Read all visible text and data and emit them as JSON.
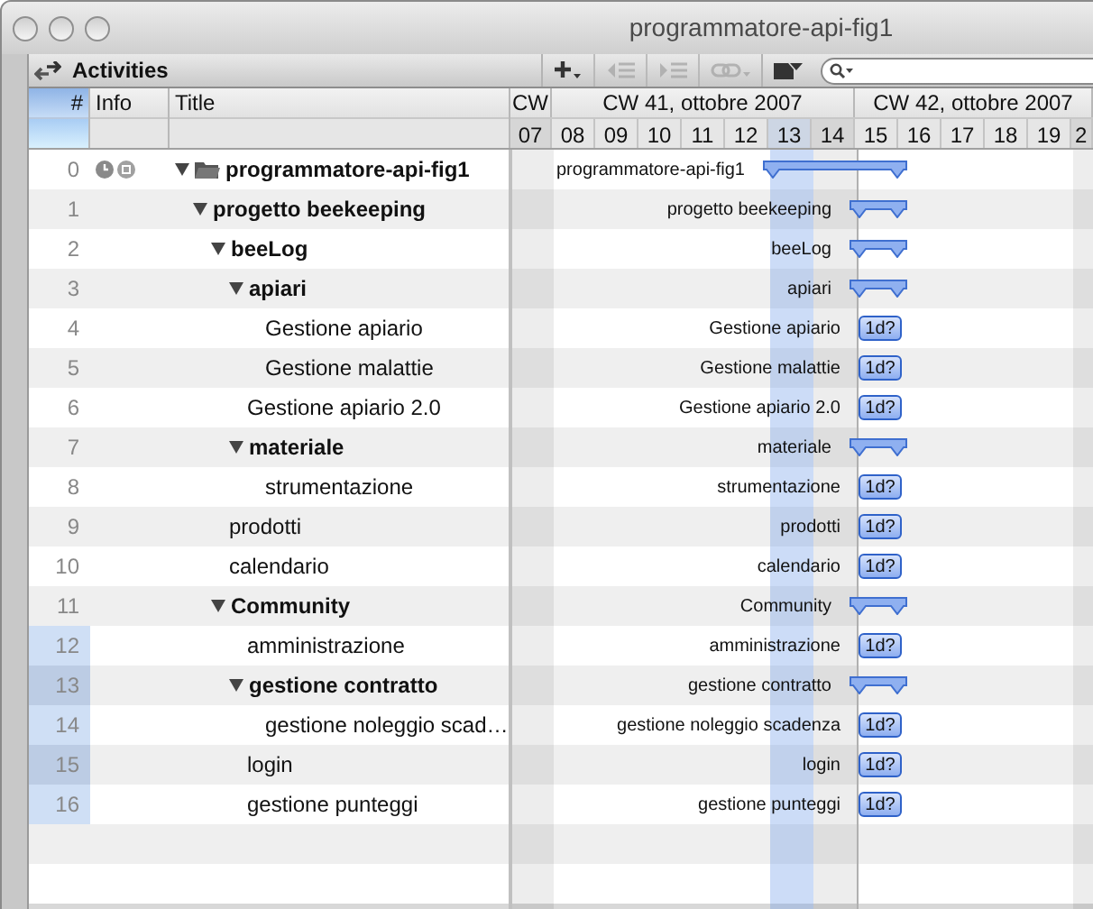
{
  "window": {
    "title": "programmatore-api-fig1"
  },
  "toolbar": {
    "title": "Activities",
    "buttons": [
      {
        "kind": "add",
        "disabled": false
      },
      {
        "kind": "outdent",
        "disabled": true
      },
      {
        "kind": "indent",
        "disabled": true
      },
      {
        "kind": "link",
        "disabled": true
      },
      {
        "kind": "filter",
        "disabled": false
      }
    ]
  },
  "table": {
    "columns": [
      "#",
      "Info",
      "Title"
    ],
    "rows": [
      {
        "number": "0",
        "title": "programmatore-api-fig1",
        "gantt_label": "programmatore-api-fig1",
        "expanded": true,
        "selected": false,
        "info": true,
        "bar": {
          "kind": "summary"
        },
        "children": [
          {
            "number": "1",
            "title": "progetto beekeeping",
            "gantt_label": "progetto beekeeping",
            "expanded": true,
            "selected": false,
            "bar": {
              "kind": "summary"
            },
            "children": [
              {
                "number": "2",
                "title": "beeLog",
                "gantt_label": "beeLog",
                "expanded": true,
                "selected": false,
                "bar": {
                  "kind": "summary"
                },
                "children": [
                  {
                    "number": "3",
                    "title": "apiari",
                    "gantt_label": "apiari",
                    "expanded": true,
                    "selected": false,
                    "bar": {
                      "kind": "summary"
                    },
                    "children": [
                      {
                        "number": "4",
                        "title": "Gestione apiario",
                        "gantt_label": "Gestione apiario",
                        "selected": false,
                        "bar": {
                          "kind": "task",
                          "label": "1d?"
                        }
                      },
                      {
                        "number": "5",
                        "title": "Gestione malattie",
                        "gantt_label": "Gestione malattie",
                        "selected": false,
                        "bar": {
                          "kind": "task",
                          "label": "1d?"
                        }
                      }
                    ]
                  },
                  {
                    "number": "6",
                    "title": "Gestione apiario 2.0",
                    "gantt_label": "Gestione apiario 2.0",
                    "selected": false,
                    "bar": {
                      "kind": "task",
                      "label": "1d?"
                    }
                  },
                  {
                    "number": "7",
                    "title": "materiale",
                    "gantt_label": "materiale",
                    "expanded": true,
                    "selected": false,
                    "bar": {
                      "kind": "summary"
                    },
                    "children": [
                      {
                        "number": "8",
                        "title": "strumentazione",
                        "gantt_label": "strumentazione",
                        "selected": false,
                        "bar": {
                          "kind": "task",
                          "label": "1d?"
                        }
                      }
                    ]
                  }
                ]
              },
              {
                "number": "9",
                "title": "prodotti",
                "gantt_label": "prodotti",
                "selected": false,
                "bar": {
                  "kind": "task",
                  "label": "1d?"
                }
              },
              {
                "number": "10",
                "title": "calendario",
                "gantt_label": "calendario",
                "selected": false,
                "bar": {
                  "kind": "task",
                  "label": "1d?"
                }
              },
              {
                "number": "11",
                "title": "Community",
                "gantt_label": "Community",
                "expanded": true,
                "selected": false,
                "bar": {
                  "kind": "summary"
                },
                "children": [
                  {
                    "number": "12",
                    "title": "amministrazione",
                    "gantt_label": "amministrazione",
                    "selected": true,
                    "bar": {
                      "kind": "task",
                      "label": "1d?"
                    }
                  },
                  {
                    "number": "13",
                    "title": "gestione contratto",
                    "gantt_label": "gestione contratto",
                    "expanded": true,
                    "selected": true,
                    "bar": {
                      "kind": "summary"
                    },
                    "children": [
                      {
                        "number": "14",
                        "title": "gestione noleggio scad…",
                        "gantt_label": "gestione noleggio scadenza",
                        "selected": true,
                        "bar": {
                          "kind": "task",
                          "label": "1d?"
                        }
                      }
                    ]
                  },
                  {
                    "number": "15",
                    "title": "login",
                    "gantt_label": "login",
                    "selected": true,
                    "bar": {
                      "kind": "task",
                      "label": "1d?"
                    }
                  },
                  {
                    "number": "16",
                    "title": "gestione punteggi",
                    "gantt_label": "gestione punteggi",
                    "selected": true,
                    "bar": {
                      "kind": "task",
                      "label": "1d?"
                    }
                  }
                ]
              }
            ]
          }
        ]
      }
    ]
  },
  "gantt": {
    "weeks": [
      {
        "label": "CW",
        "days": [
          {
            "label": "07",
            "kind": "weekend"
          }
        ]
      },
      {
        "label": "CW 41, ottobre 2007",
        "days": [
          {
            "label": "08",
            "kind": "weekday"
          },
          {
            "label": "09",
            "kind": "weekday"
          },
          {
            "label": "10",
            "kind": "weekday"
          },
          {
            "label": "11",
            "kind": "weekday"
          },
          {
            "label": "12",
            "kind": "weekday"
          },
          {
            "label": "13",
            "kind": "highlighted"
          },
          {
            "label": "14",
            "kind": "weekend"
          }
        ]
      },
      {
        "label": "CW 42, ottobre 2007",
        "days": [
          {
            "label": "15",
            "kind": "weekday"
          },
          {
            "label": "16",
            "kind": "weekday"
          },
          {
            "label": "17",
            "kind": "weekday"
          },
          {
            "label": "18",
            "kind": "weekday"
          },
          {
            "label": "19",
            "kind": "weekday"
          },
          {
            "label": "2",
            "kind": "weekend"
          }
        ]
      }
    ]
  }
}
